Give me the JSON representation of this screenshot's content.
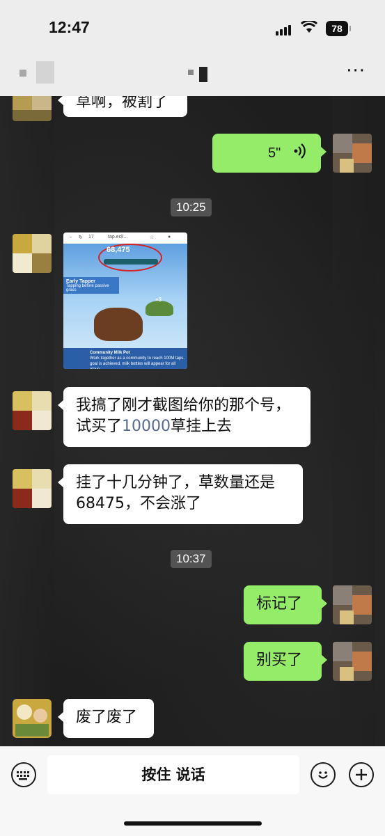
{
  "status_bar": {
    "time": "12:47",
    "battery": "78"
  },
  "nav": {
    "more_label": "···"
  },
  "messages": {
    "partial_top": "草啊，被割了",
    "voice_duration": "5\"",
    "timestamp_1": "10:25",
    "screenshot": {
      "url": "tap.ecli…",
      "tab_count": "17",
      "score": "68,475",
      "panel_title": "Early Tapper",
      "panel_sub": "Tapping before passive grass",
      "badge": "+3",
      "milk_title": "Community Milk Pot",
      "milk_text": "Work together as a community to reach 100M taps. goal is achieved, milk bottles will appear for all playe"
    },
    "msg_2_part1": "我搞了刚才截图给你的那个号，",
    "msg_2_part2_prefix": "试买了",
    "msg_2_number": "10000",
    "msg_2_part2_suffix": "草挂上去",
    "msg_3_line1": "挂了十几分钟了，草数量还是",
    "msg_3_line2": "68475，不会涨了",
    "timestamp_2": "10:37",
    "msg_4": "标记了",
    "msg_5": "别买了",
    "msg_6": "废了废了"
  },
  "input_bar": {
    "hold_to_talk": "按住 说话"
  },
  "colors": {
    "green_bubble": "#95ec69",
    "link_number": "#576b95"
  }
}
